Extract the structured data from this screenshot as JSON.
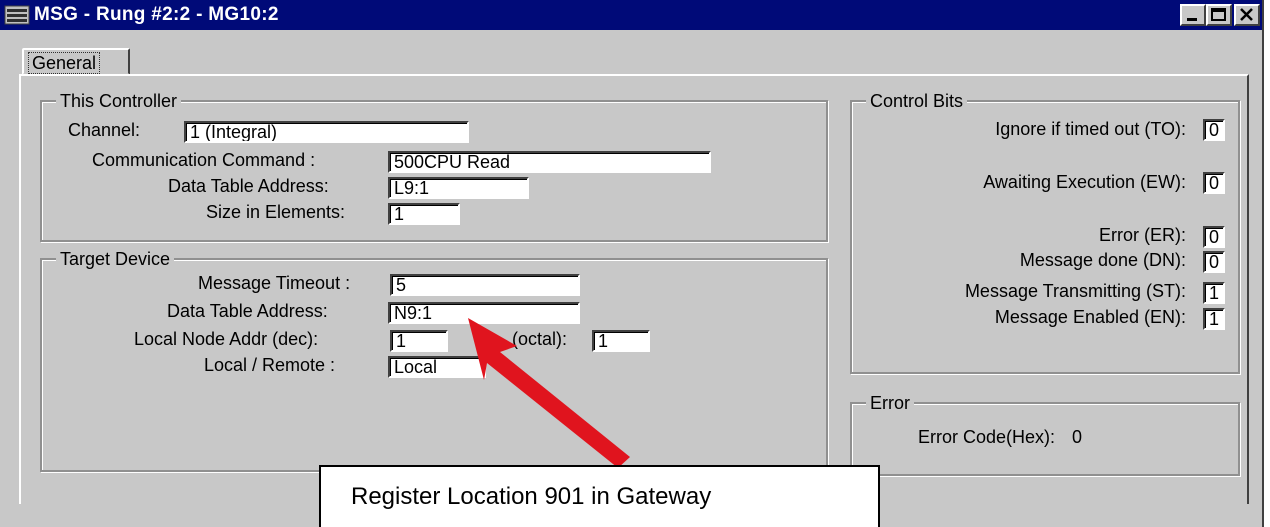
{
  "window": {
    "title": "MSG - Rung #2:2 - MG10:2",
    "buttons": [
      "minimize",
      "maximize",
      "close"
    ]
  },
  "tabs": [
    {
      "label": "General",
      "selected": true
    }
  ],
  "this_controller": {
    "title": "This Controller",
    "channel_label": "Channel:",
    "channel_value": "1 (Integral)",
    "command_label": "Communication Command :",
    "command_value": "500CPU Read",
    "address_label": "Data Table Address:",
    "address_value": "L9:1",
    "size_label": "Size in Elements:",
    "size_value": "1"
  },
  "target_device": {
    "title": "Target Device",
    "timeout_label": "Message Timeout :",
    "timeout_value": "5",
    "address_label": "Data Table Address:",
    "address_value": "N9:1",
    "node_dec_label": "Local Node Addr (dec):",
    "node_dec_value": "1",
    "node_octal_label": "(octal):",
    "node_octal_value": "1",
    "remote_label": "Local / Remote :",
    "remote_value": "Local"
  },
  "control_bits": {
    "title": "Control Bits",
    "items": [
      {
        "label": "Ignore if timed out (TO):",
        "value": "0"
      },
      {
        "label": "Awaiting Execution (EW):",
        "value": "0"
      },
      {
        "label": "Error (ER):",
        "value": "0"
      },
      {
        "label": "Message done (DN):",
        "value": "0"
      },
      {
        "label": "Message Transmitting (ST):",
        "value": "1"
      },
      {
        "label": "Message Enabled (EN):",
        "value": "1"
      }
    ]
  },
  "error": {
    "title": "Error",
    "code_label": "Error Code(Hex):",
    "code_value": "0"
  },
  "annotation": {
    "text": "Register Location 901 in Gateway",
    "arrow_color": "#e0141e"
  },
  "colors": {
    "titlebar": "#000a78",
    "face": "#c8c8c8"
  }
}
